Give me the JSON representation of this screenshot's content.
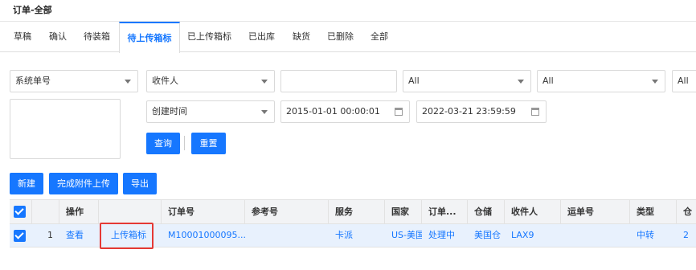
{
  "page": {
    "title": "订单-全部"
  },
  "tabs": [
    "草稿",
    "确认",
    "待装箱",
    "待上传箱标",
    "已上传箱标",
    "已出库",
    "缺货",
    "已删除",
    "全部"
  ],
  "filters": {
    "search_type": "系统单号",
    "recipient_type": "收件人",
    "recipient_value": "",
    "select_all_1": "All",
    "select_all_2": "All",
    "select_all_3": "All",
    "date_type": "创建时间",
    "date_start": "2015-01-01 00:00:01",
    "date_end": "2022-03-21 23:59:59",
    "query_label": "查询",
    "reset_label": "重置"
  },
  "actions": {
    "new_label": "新建",
    "complete_upload_label": "完成附件上传",
    "export_label": "导出"
  },
  "table": {
    "columns": [
      "操作",
      "",
      "订单号",
      "参考号",
      "服务",
      "国家",
      "订单...",
      "仓储",
      "收件人",
      "运单号",
      "类型",
      "仓"
    ],
    "rows": [
      {
        "index": "1",
        "view": "查看",
        "upload": "上传箱标",
        "order_no": "M10001000095...",
        "ref_no": "",
        "service": "卡派",
        "country": "US-美国",
        "status": "处理中",
        "warehouse": "美国仓",
        "recipient": "LAX9",
        "waybill": "",
        "type": "中转",
        "extra": "2"
      }
    ]
  },
  "colors": {
    "accent": "#1677ff",
    "highlight": "#e53935"
  }
}
